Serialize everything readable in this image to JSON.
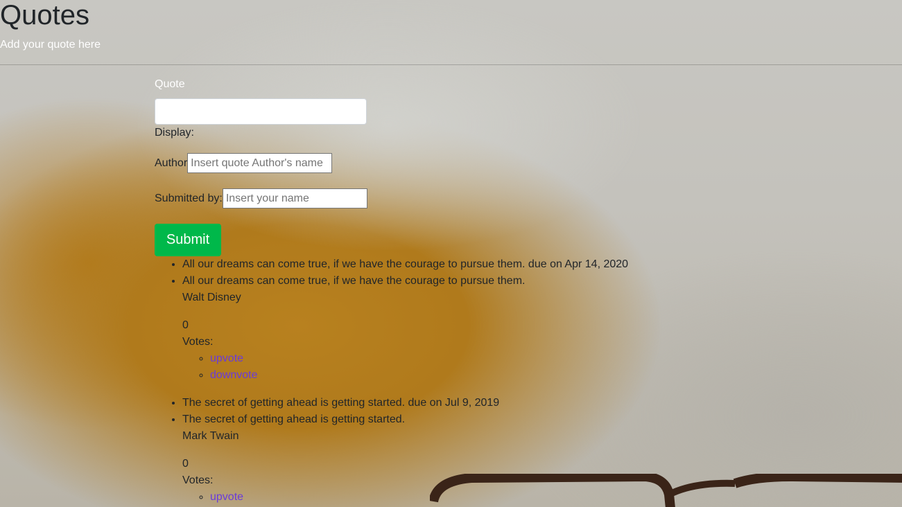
{
  "header": {
    "title": "Quotes",
    "subtitle": "Add your quote here"
  },
  "form": {
    "quote_label": "Quote",
    "quote_value": "",
    "display_label": "Display:",
    "author_label": "Author",
    "author_placeholder": "Insert quote Author's name",
    "submitter_label": "Submitted by:",
    "submitter_placeholder": "Insert your name",
    "submit_label": "Submit"
  },
  "quotes": [
    {
      "due_line": "All our dreams can come true, if we have the courage to pursue them. due on Apr 14, 2020",
      "text": "All our dreams can come true, if we have the courage to pursue them.",
      "author": "Walt Disney",
      "votes": "0",
      "votes_label": "Votes:",
      "upvote": "upvote",
      "downvote": "downvote"
    },
    {
      "due_line": "The secret of getting ahead is getting started. due on Jul 9, 2019",
      "text": "The secret of getting ahead is getting started.",
      "author": "Mark Twain",
      "votes": "0",
      "votes_label": "Votes:",
      "upvote": "upvote"
    }
  ],
  "colors": {
    "submit_bg": "#00b84a",
    "link": "#6a3bd9"
  }
}
